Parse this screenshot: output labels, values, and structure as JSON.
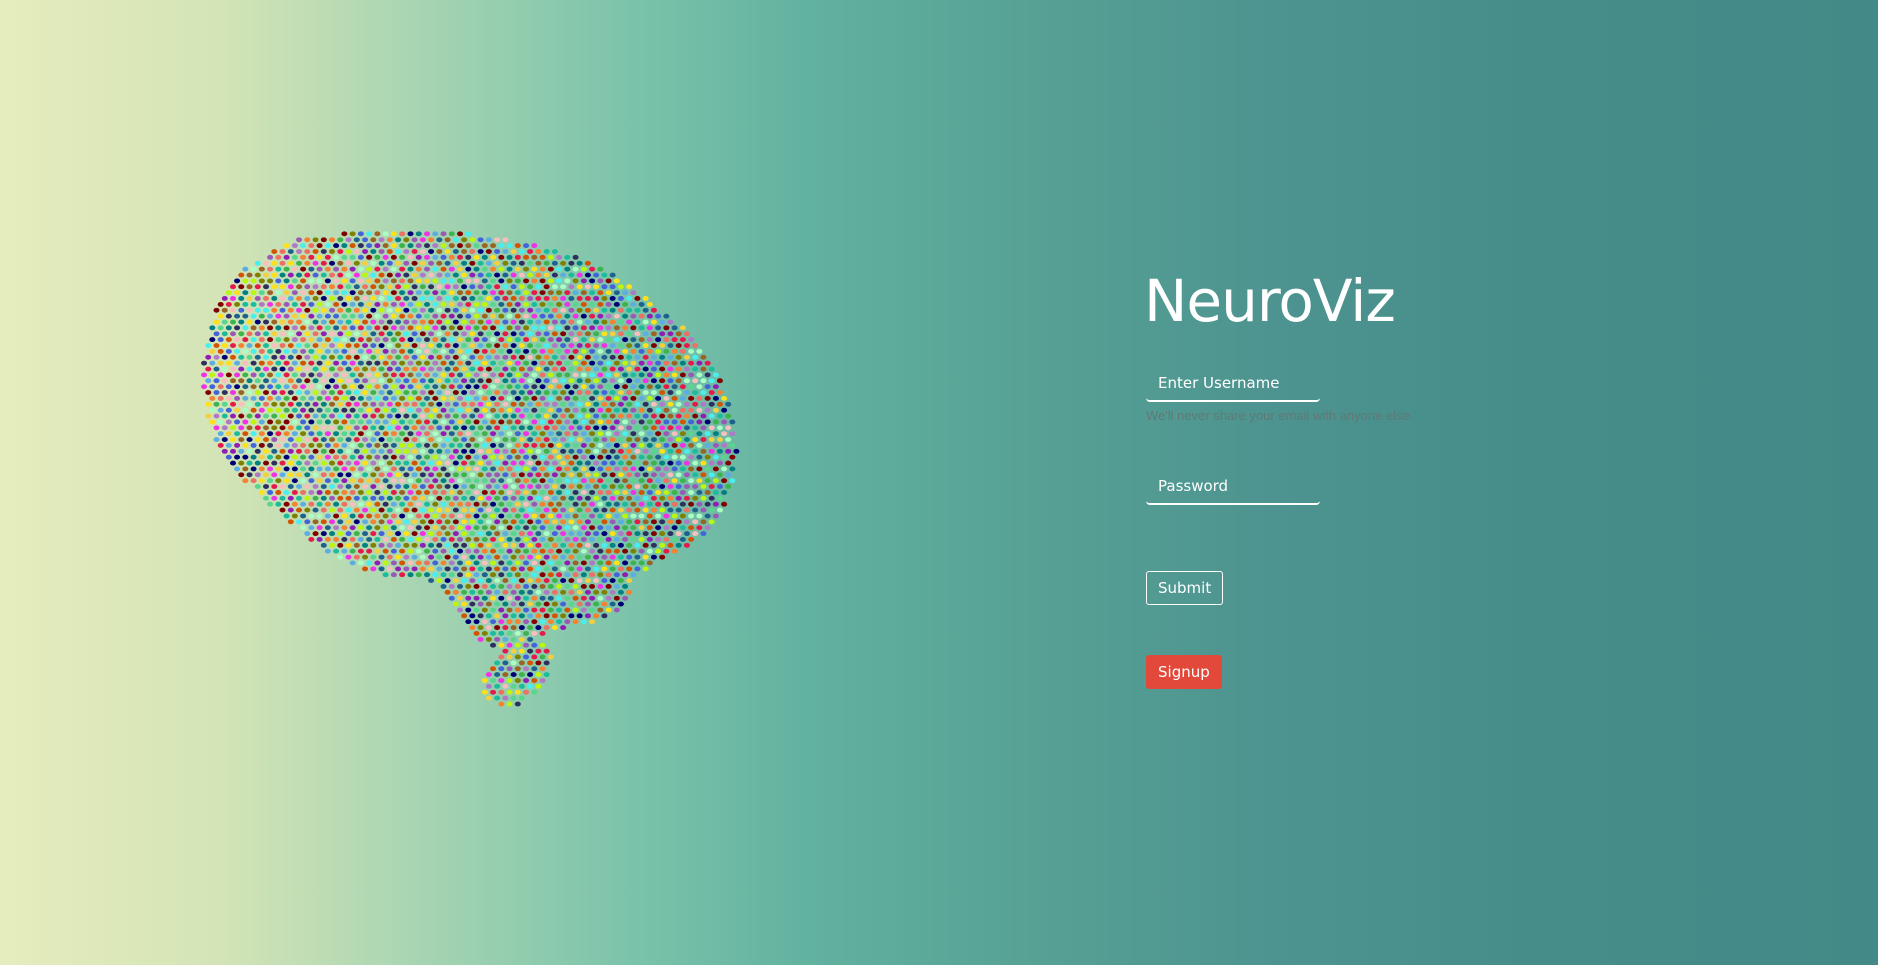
{
  "app": {
    "title": "NeuroViz"
  },
  "login_form": {
    "username_placeholder": "Enter Username",
    "username_help": "We'll never share your email with anyone else.",
    "password_placeholder": "Password",
    "submit_label": "Submit",
    "signup_label": "Signup"
  },
  "illustration": {
    "icon": "brain-dot-mosaic-icon",
    "dot_palette": [
      "#e6194b",
      "#3cb44b",
      "#ffe119",
      "#4363d8",
      "#f58231",
      "#911eb4",
      "#46f0f0",
      "#f032e6",
      "#bcf60c",
      "#fabebe",
      "#008080",
      "#9a6324",
      "#800000",
      "#aaffc3",
      "#808000",
      "#000075",
      "#2f2f5f",
      "#9b59b6",
      "#1abc9c",
      "#d35400",
      "#5dade2",
      "#58d68d",
      "#ec7063",
      "#f4d03f",
      "#af7ac5",
      "#1f618d"
    ]
  },
  "colors": {
    "signup_button": "#e2493a",
    "help_text": "#5f7a77",
    "gradient_left": "#e6ecbe",
    "gradient_right": "#438987"
  }
}
